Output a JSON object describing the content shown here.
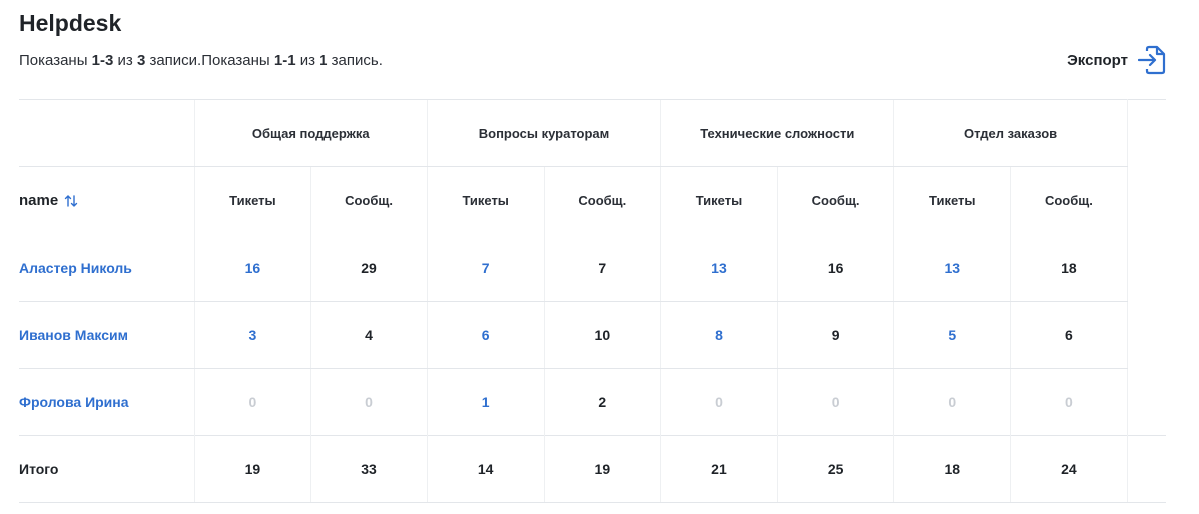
{
  "header": {
    "title": "Helpdesk",
    "summary": {
      "prefix1": "Показаны ",
      "range1": "1-3",
      "mid1": " из ",
      "total1": "3",
      "suffix1": " записи.Показаны ",
      "range2": "1-1",
      "mid2": " из ",
      "total2": "1",
      "suffix2": " запись."
    },
    "export_label": "Экспорт"
  },
  "table": {
    "name_header": "name",
    "groups": [
      {
        "label": "Общая поддержка",
        "sub": [
          "Тикеты",
          "Сообщ."
        ]
      },
      {
        "label": "Вопросы кураторам",
        "sub": [
          "Тикеты",
          "Сообщ."
        ]
      },
      {
        "label": "Технические сложности",
        "sub": [
          "Тикеты",
          "Сообщ."
        ]
      },
      {
        "label": "Отдел заказов",
        "sub": [
          "Тикеты",
          "Сообщ."
        ]
      }
    ],
    "rows": [
      {
        "name": "Аластер Николь",
        "values": [
          "16",
          "29",
          "7",
          "7",
          "13",
          "16",
          "13",
          "18"
        ]
      },
      {
        "name": "Иванов Максим",
        "values": [
          "3",
          "4",
          "6",
          "10",
          "8",
          "9",
          "5",
          "6"
        ]
      },
      {
        "name": "Фролова Ирина",
        "values": [
          "0",
          "0",
          "1",
          "2",
          "0",
          "0",
          "0",
          "0"
        ]
      }
    ],
    "total": {
      "label": "Итого",
      "values": [
        "19",
        "33",
        "14",
        "19",
        "21",
        "25",
        "18",
        "24"
      ]
    }
  },
  "colors": {
    "link": "#2f6fcf",
    "zero": "#c9cdd3",
    "text": "#1f2328"
  },
  "icons": {
    "export": "file-export-icon",
    "sort": "sort-arrows-icon"
  }
}
